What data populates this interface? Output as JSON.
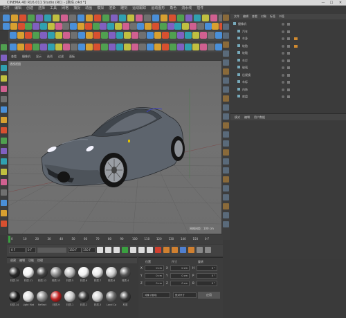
{
  "window": {
    "title": "CINEMA 4D R16.011 Studio (RC) - [跑车.c4d *]",
    "min": "—",
    "max": "□",
    "close": "✕"
  },
  "menu": [
    "文件",
    "编辑",
    "创建",
    "选择",
    "工具",
    "网格",
    "捕捉",
    "动画",
    "模拟",
    "渲染",
    "雕刻",
    "运动跟踪",
    "运动图形",
    "角色",
    "流水线",
    "插件",
    "Laubwerk",
    "X-Particles",
    "脚本",
    "窗口",
    "帮助"
  ],
  "viewport": {
    "menu": [
      "查看",
      "摄像机",
      "显示",
      "选项",
      "过滤",
      "面板"
    ],
    "camera_label": "透视视图",
    "grid_label": "网格间距 : 100 cm"
  },
  "objects": {
    "tabs": [
      "文件",
      "编辑",
      "查看",
      "对象",
      "标签",
      "书签"
    ],
    "rows": [
      "摄像机",
      "汽车",
      "车身",
      "轮胎",
      "轮毂",
      "车灯",
      "玻璃",
      "后视镜",
      "车标",
      "内饰",
      "底盘"
    ]
  },
  "attributes": {
    "tabs": [
      "模式",
      "编辑",
      "用户数据"
    ]
  },
  "timeline": {
    "ticks": [
      "0",
      "10",
      "20",
      "30",
      "40",
      "50",
      "60",
      "70",
      "80",
      "90",
      "100",
      "110",
      "120",
      "130",
      "140",
      "150"
    ],
    "frame_display": "0 F",
    "start": "0 F",
    "current": "0 F",
    "end": "150 F",
    "end2": "150 F"
  },
  "materials": {
    "menu": [
      "创建",
      "编辑",
      "功能",
      "纹理"
    ],
    "row1": [
      "材质.10",
      "材质.11",
      "材质.12",
      "材质.13",
      "材质.5",
      "材质.6",
      "材质.7",
      "材质.8",
      "材质.4"
    ],
    "row2": [
      "材质.14",
      "Light Mat",
      "Reflect",
      "材质.9",
      "材质.1",
      "材质.2",
      "材质.3",
      "Land Ca",
      "材质"
    ]
  },
  "coordinates": {
    "headers": [
      "位置",
      "尺寸",
      "旋转"
    ],
    "rows": [
      {
        "axis": "X",
        "pos": "0 cm",
        "size": "0 cm",
        "rot_axis": "H",
        "rot": "0 °"
      },
      {
        "axis": "Y",
        "pos": "0 cm",
        "size": "0 cm",
        "rot_axis": "P",
        "rot": "0 °"
      },
      {
        "axis": "Z",
        "pos": "0 cm",
        "size": "0 cm",
        "rot_axis": "B",
        "rot": "0 °"
      }
    ],
    "mode": "对象 (相对)",
    "size_mode": "绝对尺寸",
    "apply": "应用"
  }
}
